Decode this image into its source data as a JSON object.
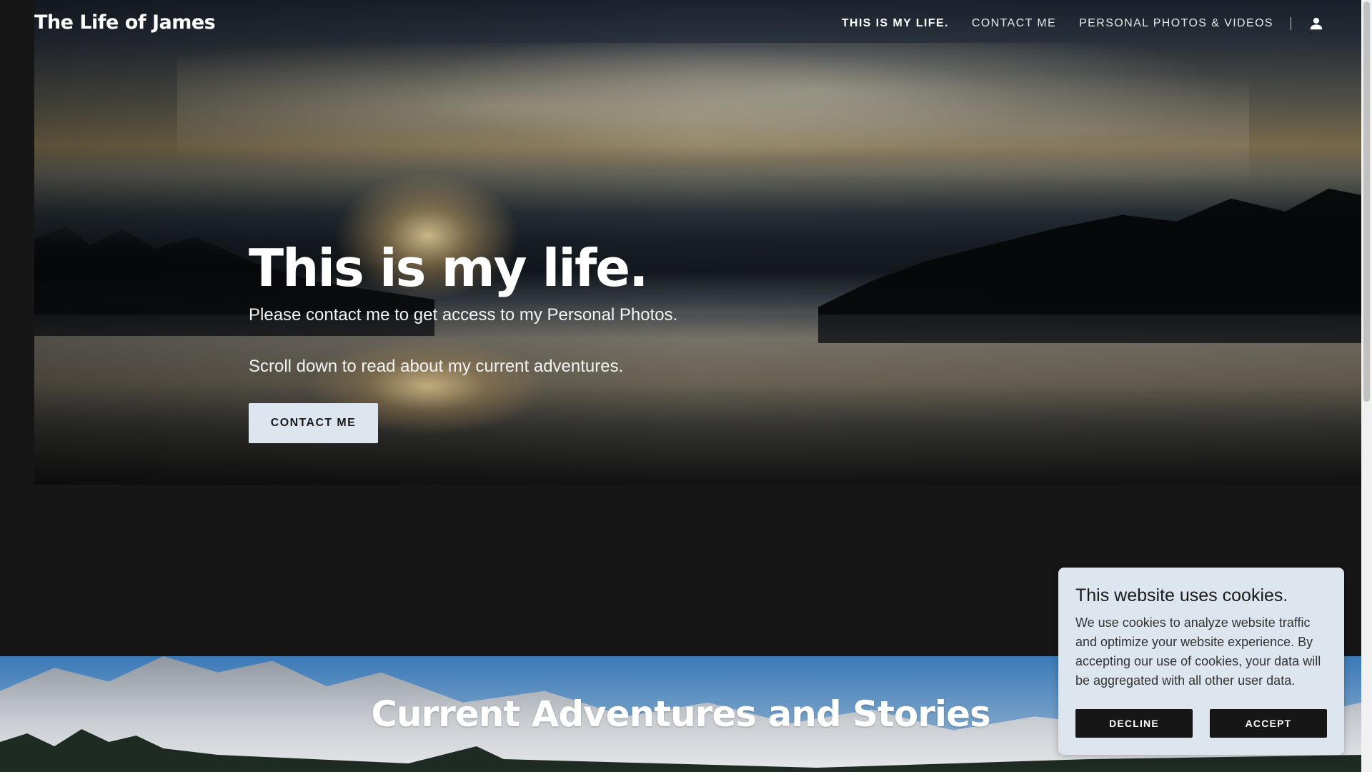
{
  "header": {
    "site_title": "The Life of James",
    "nav": [
      {
        "label": "THIS IS MY LIFE."
      },
      {
        "label": "CONTACT ME"
      },
      {
        "label": "PERSONAL PHOTOS & VIDEOS"
      }
    ],
    "account_icon": "user-icon"
  },
  "hero": {
    "title": "This is my life.",
    "text_1": "Please contact me to get access to my Personal Photos.",
    "text_2": "Scroll down to read about my current adventures.",
    "button_label": "CONTACT ME"
  },
  "adventures": {
    "title": "Current Adventures and Stories"
  },
  "cookie": {
    "title": "This website uses cookies.",
    "body": "We use cookies to analyze website traffic and optimize your website experience. By accepting our use of cookies, your data will be aggregated with all other user data.",
    "decline_label": "DECLINE",
    "accept_label": "ACCEPT"
  },
  "colors": {
    "background": "#161616",
    "button_light": "#dde6ee",
    "cookie_bg": "#dde6ee",
    "cookie_button": "#161616"
  }
}
